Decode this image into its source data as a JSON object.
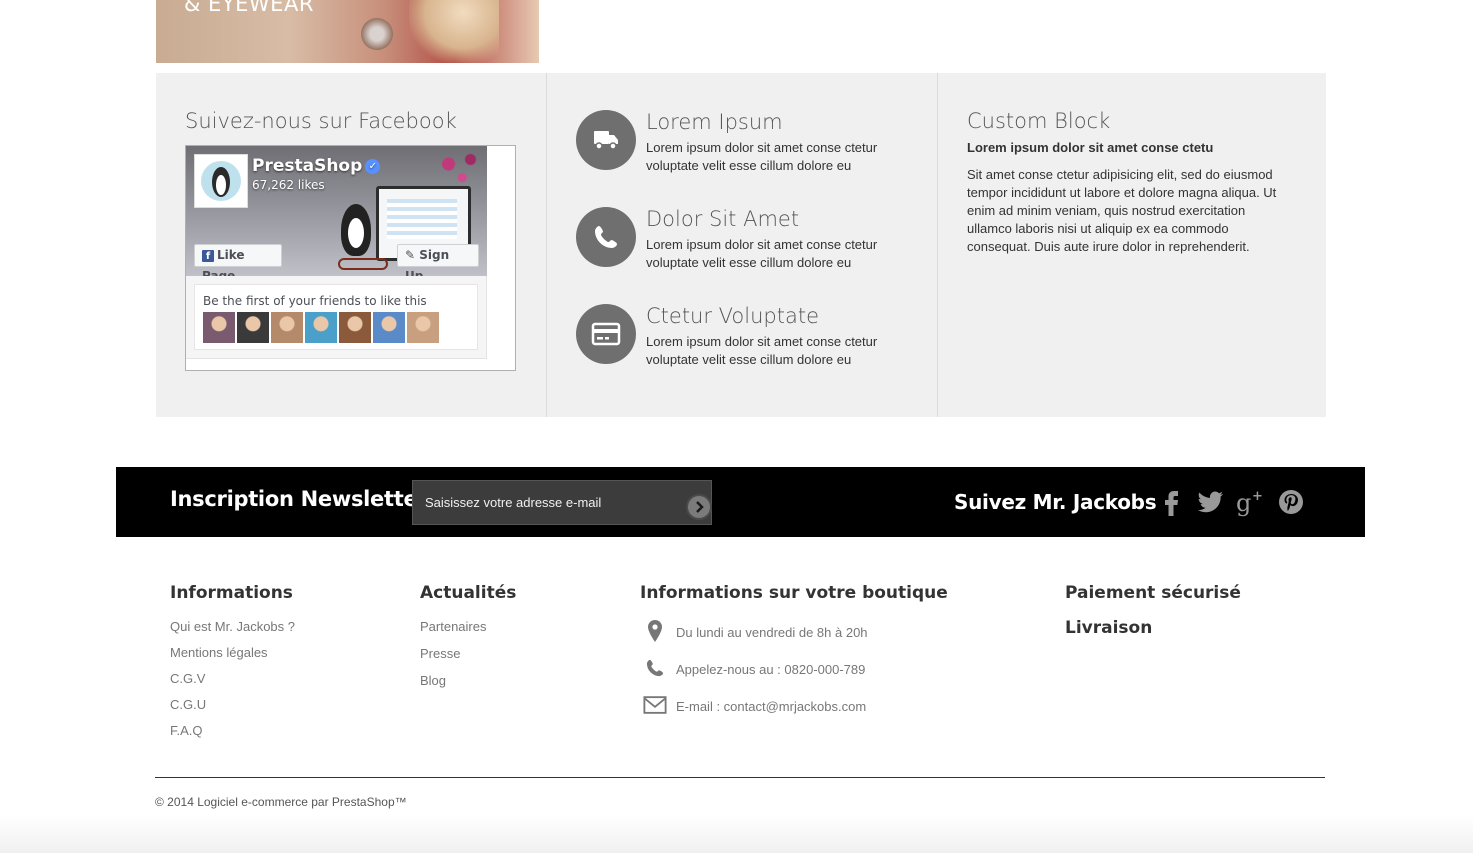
{
  "banner": {
    "text": "& EYEWEAR"
  },
  "facebook_block": {
    "title": "Suivez-nous sur Facebook",
    "page_name": "PrestaShop",
    "likes": "67,262 likes",
    "like_button": "Like Page",
    "signup_button": "Sign Up",
    "friends_text": "Be the first of your friends to like this",
    "friend_colors": [
      "#7a5a6e",
      "#3a3a3a",
      "#b58a6a",
      "#4aa0c8",
      "#8a5a3a",
      "#5a8ac8",
      "#c8a080"
    ]
  },
  "features": [
    {
      "title": "Lorem Ipsum",
      "text": "Lorem ipsum dolor sit amet conse ctetur voluptate velit esse cillum dolore eu",
      "icon": "truck-icon"
    },
    {
      "title": "Dolor Sit Amet",
      "text": "Lorem ipsum dolor sit amet conse ctetur voluptate velit esse cillum dolore eu",
      "icon": "phone-icon"
    },
    {
      "title": "Ctetur Voluptate",
      "text": "Lorem ipsum dolor sit amet conse ctetur voluptate velit esse cillum dolore eu",
      "icon": "credit-card-icon"
    }
  ],
  "custom_block": {
    "title": "Custom Block",
    "bold_text": "Lorem ipsum dolor sit amet conse ctetu",
    "text": "Sit amet conse ctetur adipisicing elit, sed do eiusmod tempor incididunt ut labore et dolore magna aliqua. Ut enim ad minim veniam, quis nostrud exercitation ullamco laboris nisi ut aliquip ex ea commodo consequat. Duis aute irure dolor in reprehenderit."
  },
  "newsletter": {
    "title": "Inscription Newsletter",
    "input_placeholder": "Saisissez votre adresse e-mail",
    "input_value": "",
    "follow_title": "Suivez Mr. Jackobs",
    "social": [
      "facebook-icon",
      "twitter-icon",
      "google-plus-icon",
      "pinterest-icon"
    ]
  },
  "footer": {
    "informations": {
      "title": "Informations",
      "links": [
        "Qui est Mr. Jackobs ?",
        "Mentions légales",
        "C.G.V",
        "C.G.U",
        "F.A.Q"
      ]
    },
    "actualites": {
      "title": "Actualités",
      "links": [
        "Partenaires",
        "Presse",
        "Blog"
      ]
    },
    "store_info": {
      "title": "Informations sur votre boutique",
      "hours": "Du lundi au vendredi de 8h à 20h",
      "phone": "Appelez-nous au : 0820-000-789",
      "email": "E-mail : contact@mrjackobs.com"
    },
    "payment": {
      "title": "Paiement sécurisé",
      "delivery": "Livraison"
    },
    "copyright": "© 2014 Logiciel e-commerce par PrestaShop™"
  },
  "colors": {
    "block_bg": "#f0f0f0",
    "newsletter_bg": "#000000",
    "icon_circle": "#6f6f6f",
    "link": "#777777"
  }
}
